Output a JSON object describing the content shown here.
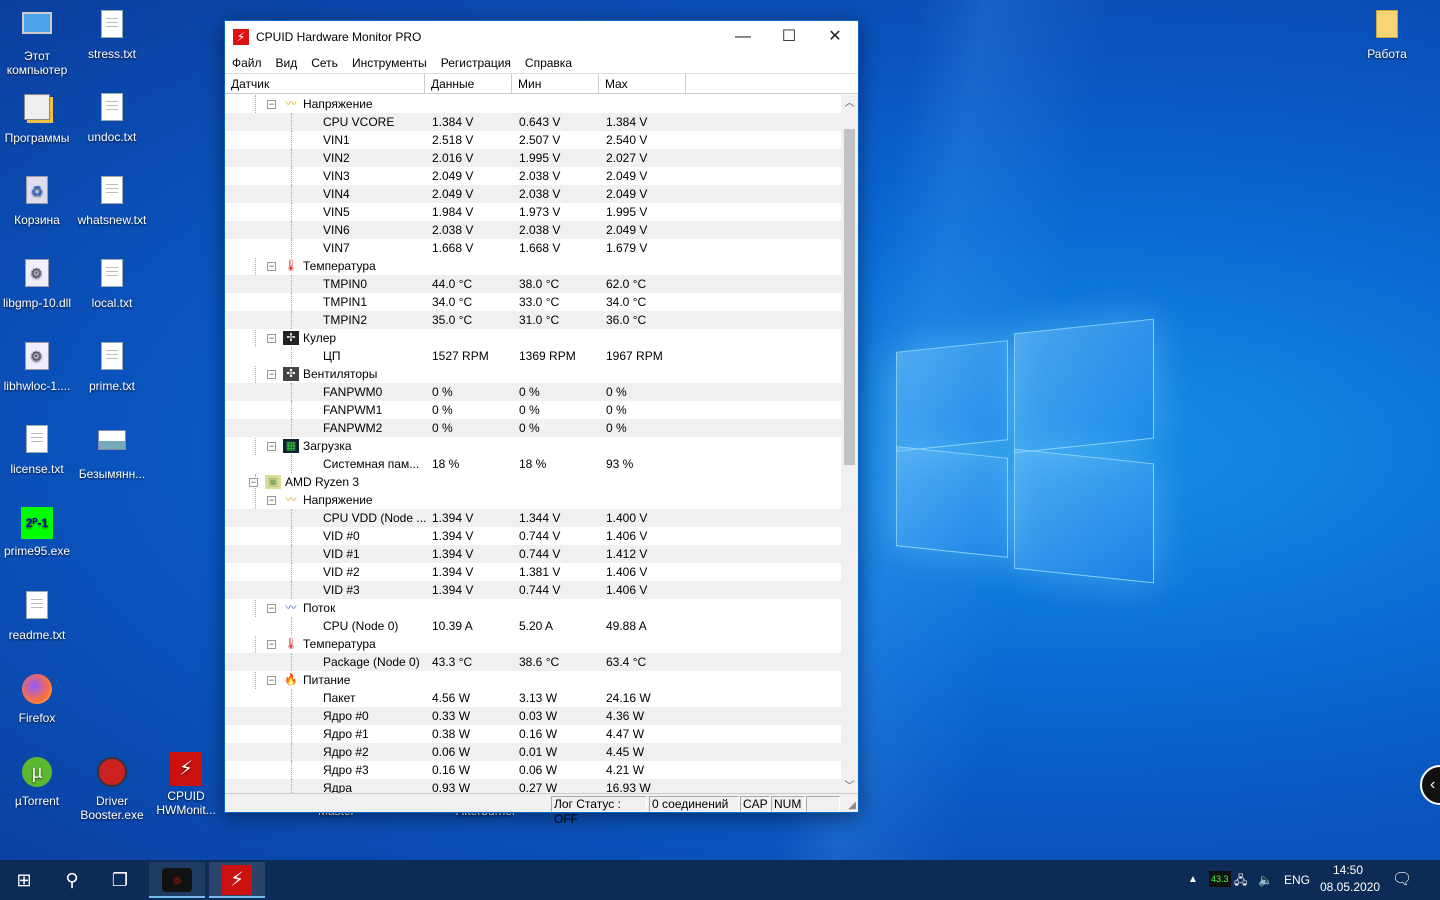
{
  "desktop": {
    "icons_col1": [
      {
        "label": "Этот компьютер",
        "icon": "computer-icon"
      },
      {
        "label": "Программы",
        "icon": "folder-programs-icon"
      },
      {
        "label": "Корзина",
        "icon": "recycle-bin-icon"
      },
      {
        "label": "libgmp-10.dll",
        "icon": "dll-icon"
      },
      {
        "label": "libhwloc-1....",
        "icon": "dll-icon"
      },
      {
        "label": "license.txt",
        "icon": "text-file-icon"
      },
      {
        "label": "prime95.exe",
        "icon": "prime95-icon"
      },
      {
        "label": "readme.txt",
        "icon": "text-file-icon"
      },
      {
        "label": "Firefox",
        "icon": "firefox-icon"
      },
      {
        "label": "µTorrent",
        "icon": "utorrent-icon"
      }
    ],
    "icons_col2": [
      {
        "label": "stress.txt",
        "icon": "text-file-icon"
      },
      {
        "label": "undoc.txt",
        "icon": "text-file-icon"
      },
      {
        "label": "whatsnew.txt",
        "icon": "text-file-icon"
      },
      {
        "label": "local.txt",
        "icon": "text-file-icon"
      },
      {
        "label": "prime.txt",
        "icon": "text-file-icon"
      },
      {
        "label": "Безымянн...",
        "icon": "image-file-icon"
      },
      {
        "label": "Driver Booster.exe",
        "icon": "driver-booster-icon"
      }
    ],
    "icon_cpuid": {
      "label": "CPUID HWMonit...",
      "icon": "cpuid-hwmonitor-icon"
    },
    "icon_right": {
      "label": "Работа",
      "icon": "folder-icon"
    },
    "hidden_labels": [
      "Master",
      "Afterburner"
    ]
  },
  "window": {
    "title": "CPUID Hardware Monitor PRO",
    "app_icon_glyph": "⚡",
    "controls": {
      "minimize": "—",
      "maximize": "☐",
      "close": "✕"
    },
    "menu": [
      "Файл",
      "Вид",
      "Сеть",
      "Инструменты",
      "Регистрация",
      "Справка"
    ],
    "columns": [
      "Датчик",
      "Данные",
      "Мин",
      "Max"
    ]
  },
  "tree": [
    {
      "type": "cat",
      "level": 2,
      "label": "Напряжение",
      "icon": "voltage-icon"
    },
    {
      "type": "leaf",
      "label": "CPU VCORE",
      "v": "1.384 V",
      "min": "0.643 V",
      "max": "1.384 V"
    },
    {
      "type": "leaf",
      "label": "VIN1",
      "v": "2.518 V",
      "min": "2.507 V",
      "max": "2.540 V"
    },
    {
      "type": "leaf",
      "label": "VIN2",
      "v": "2.016 V",
      "min": "1.995 V",
      "max": "2.027 V"
    },
    {
      "type": "leaf",
      "label": "VIN3",
      "v": "2.049 V",
      "min": "2.038 V",
      "max": "2.049 V"
    },
    {
      "type": "leaf",
      "label": "VIN4",
      "v": "2.049 V",
      "min": "2.038 V",
      "max": "2.049 V"
    },
    {
      "type": "leaf",
      "label": "VIN5",
      "v": "1.984 V",
      "min": "1.973 V",
      "max": "1.995 V"
    },
    {
      "type": "leaf",
      "label": "VIN6",
      "v": "2.038 V",
      "min": "2.038 V",
      "max": "2.049 V"
    },
    {
      "type": "leaf",
      "label": "VIN7",
      "v": "1.668 V",
      "min": "1.668 V",
      "max": "1.679 V"
    },
    {
      "type": "cat",
      "level": 2,
      "label": "Температура",
      "icon": "thermometer-icon"
    },
    {
      "type": "leaf",
      "label": "TMPIN0",
      "v": "44.0 °C",
      "min": "38.0 °C",
      "max": "62.0 °C"
    },
    {
      "type": "leaf",
      "label": "TMPIN1",
      "v": "34.0 °C",
      "min": "33.0 °C",
      "max": "34.0 °C"
    },
    {
      "type": "leaf",
      "label": "TMPIN2",
      "v": "35.0 °C",
      "min": "31.0 °C",
      "max": "36.0 °C"
    },
    {
      "type": "cat",
      "level": 2,
      "label": "Кулер",
      "icon": "cooler-icon"
    },
    {
      "type": "leaf",
      "label": "ЦП",
      "v": "1527 RPM",
      "min": "1369 RPM",
      "max": "1967 RPM"
    },
    {
      "type": "cat",
      "level": 2,
      "label": "Вентиляторы",
      "icon": "fan-icon"
    },
    {
      "type": "leaf",
      "label": "FANPWM0",
      "v": "0 %",
      "min": "0 %",
      "max": "0 %"
    },
    {
      "type": "leaf",
      "label": "FANPWM1",
      "v": "0 %",
      "min": "0 %",
      "max": "0 %"
    },
    {
      "type": "leaf",
      "label": "FANPWM2",
      "v": "0 %",
      "min": "0 %",
      "max": "0 %"
    },
    {
      "type": "cat",
      "level": 2,
      "label": "Загрузка",
      "icon": "load-icon"
    },
    {
      "type": "leaf",
      "label": "Системная пам...",
      "v": "18 %",
      "min": "18 %",
      "max": "93 %"
    },
    {
      "type": "cat",
      "level": 1,
      "label": "AMD Ryzen 3",
      "icon": "cpu-chip-icon"
    },
    {
      "type": "cat",
      "level": 2,
      "label": "Напряжение",
      "icon": "voltage-icon"
    },
    {
      "type": "leaf",
      "label": "CPU VDD (Node ...",
      "v": "1.394 V",
      "min": "1.344 V",
      "max": "1.400 V"
    },
    {
      "type": "leaf",
      "label": "VID #0",
      "v": "1.394 V",
      "min": "0.744 V",
      "max": "1.406 V"
    },
    {
      "type": "leaf",
      "label": "VID #1",
      "v": "1.394 V",
      "min": "0.744 V",
      "max": "1.412 V"
    },
    {
      "type": "leaf",
      "label": "VID #2",
      "v": "1.394 V",
      "min": "1.381 V",
      "max": "1.406 V"
    },
    {
      "type": "leaf",
      "label": "VID #3",
      "v": "1.394 V",
      "min": "0.744 V",
      "max": "1.406 V"
    },
    {
      "type": "cat",
      "level": 2,
      "label": "Поток",
      "icon": "current-icon"
    },
    {
      "type": "leaf",
      "label": "CPU (Node 0)",
      "v": "10.39 A",
      "min": "5.20 A",
      "max": "49.88 A"
    },
    {
      "type": "cat",
      "level": 2,
      "label": "Температура",
      "icon": "thermometer-icon"
    },
    {
      "type": "leaf",
      "label": "Package (Node 0)",
      "v": "43.3 °C",
      "min": "38.6 °C",
      "max": "63.4 °C"
    },
    {
      "type": "cat",
      "level": 2,
      "label": "Питание",
      "icon": "power-icon"
    },
    {
      "type": "leaf",
      "label": "Пакет",
      "v": "4.56 W",
      "min": "3.13 W",
      "max": "24.16 W"
    },
    {
      "type": "leaf",
      "label": "Ядро #0",
      "v": "0.33 W",
      "min": "0.03 W",
      "max": "4.36 W"
    },
    {
      "type": "leaf",
      "label": "Ядро #1",
      "v": "0.38 W",
      "min": "0.16 W",
      "max": "4.47 W"
    },
    {
      "type": "leaf",
      "label": "Ядро #2",
      "v": "0.06 W",
      "min": "0.01 W",
      "max": "4.45 W"
    },
    {
      "type": "leaf",
      "label": "Ядро #3",
      "v": "0.16 W",
      "min": "0.06 W",
      "max": "4.21 W"
    },
    {
      "type": "leaf",
      "label": "Ядра",
      "v": "0.93 W",
      "min": "0.27 W",
      "max": "16.93 W"
    }
  ],
  "statusbar": {
    "log": "Лог Статус : OFF",
    "connections": "0 соединений",
    "cap": "CAP",
    "num": "NUM"
  },
  "taskbar": {
    "tray_temp": "43.3",
    "lang": "ENG",
    "time": "14:50",
    "date": "08.05.2020"
  },
  "colors": {
    "accent": "#0a64c8",
    "taskbar": "#0d2b57",
    "row_alt": "#f0f0f0"
  }
}
